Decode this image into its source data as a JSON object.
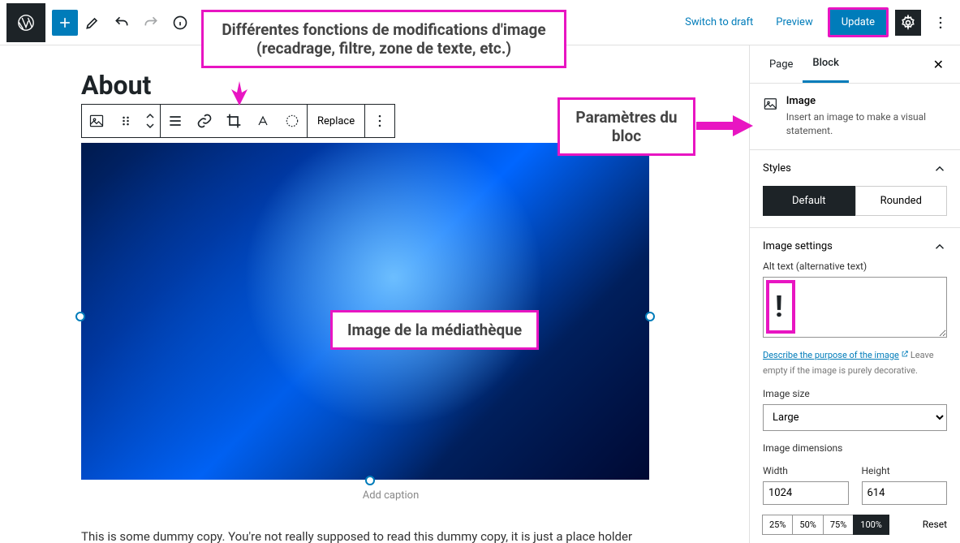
{
  "topbar": {
    "switch_draft": "Switch to draft",
    "preview": "Preview",
    "update": "Update"
  },
  "editor": {
    "page_title": "About",
    "replace_label": "Replace",
    "caption_placeholder": "Add caption",
    "dummy_text": "This is some dummy copy. You're not really supposed to read this dummy copy, it is just a place holder"
  },
  "sidebar": {
    "tabs": {
      "page": "Page",
      "block": "Block"
    },
    "block_info": {
      "title": "Image",
      "desc": "Insert an image to make a visual statement."
    },
    "styles": {
      "heading": "Styles",
      "default": "Default",
      "rounded": "Rounded"
    },
    "image_settings": {
      "heading": "Image settings",
      "alt_label": "Alt text (alternative text)",
      "desc_link": "Describe the purpose of the image",
      "desc_hint": "Leave empty if the image is purely decorative.",
      "size_label": "Image size",
      "size_value": "Large",
      "dim_heading": "Image dimensions",
      "width_label": "Width",
      "width_value": "1024",
      "height_label": "Height",
      "height_value": "614",
      "pct_25": "25%",
      "pct_50": "50%",
      "pct_75": "75%",
      "pct_100": "100%",
      "reset": "Reset"
    }
  },
  "annotations": {
    "functions": "Différentes fonctions de modifications d'image (recadrage, filtre, zone de texte, etc.)",
    "media": "Image de la médiathèque",
    "params": "Paramètres du bloc"
  }
}
